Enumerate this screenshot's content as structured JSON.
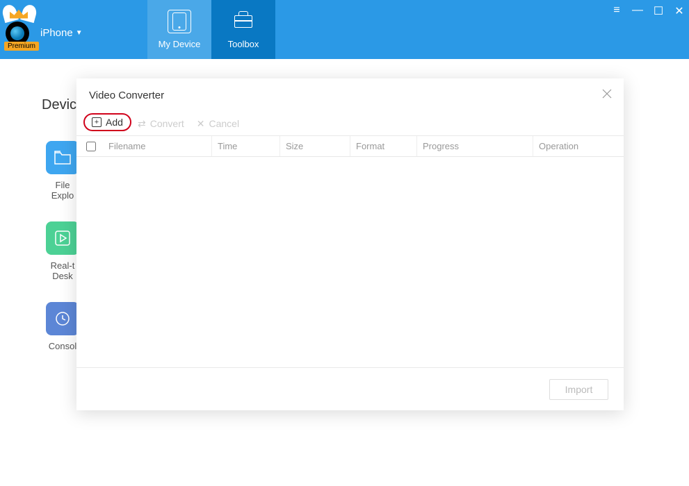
{
  "header": {
    "premium_badge": "Premium",
    "device_label": "iPhone",
    "tabs": {
      "my_device": "My Device",
      "toolbox": "Toolbox"
    }
  },
  "background": {
    "heading_partial": "Devic",
    "tools": {
      "file_explorer_line1": "File",
      "file_explorer_line2": "Explo",
      "realtime_line1": "Real-t",
      "realtime_line2": "Desk",
      "console": "Consol"
    }
  },
  "modal": {
    "title": "Video Converter",
    "toolbar": {
      "add": "Add",
      "convert": "Convert",
      "cancel": "Cancel"
    },
    "columns": {
      "filename": "Filename",
      "time": "Time",
      "size": "Size",
      "format": "Format",
      "progress": "Progress",
      "operation": "Operation"
    },
    "footer": {
      "import": "Import"
    }
  }
}
